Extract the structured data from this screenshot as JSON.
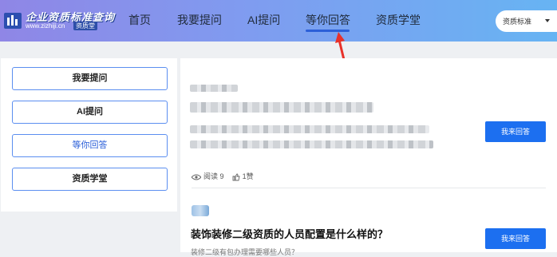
{
  "header": {
    "logo_title": "企业资质标准查询",
    "logo_url": "www.zizhiji.cn",
    "logo_brand": "资质堂",
    "nav": [
      "首页",
      "我要提问",
      "AI提问",
      "等你回答",
      "资质学堂"
    ],
    "active_nav": "等你回答",
    "search_category": "资质标准"
  },
  "sidebar": {
    "items": [
      "我要提问",
      "AI提问",
      "等你回答",
      "资质学堂"
    ],
    "active": "等你回答"
  },
  "questions": [
    {
      "title": "",
      "views_label": "阅读",
      "views": "9",
      "likes": "1",
      "likes_label": "赞",
      "answer_button": "我来回答"
    },
    {
      "title": "装饰装修二级资质的人员配置是什么样的？",
      "subtitle": "装修二级有包办理需要哪些人员？",
      "answer_button": "我来回答"
    }
  ],
  "colors": {
    "accent": "#1c6ff0",
    "nav_gradient_start": "#8f86e6",
    "nav_gradient_end": "#67b4f3",
    "arrow": "#e8312a"
  }
}
